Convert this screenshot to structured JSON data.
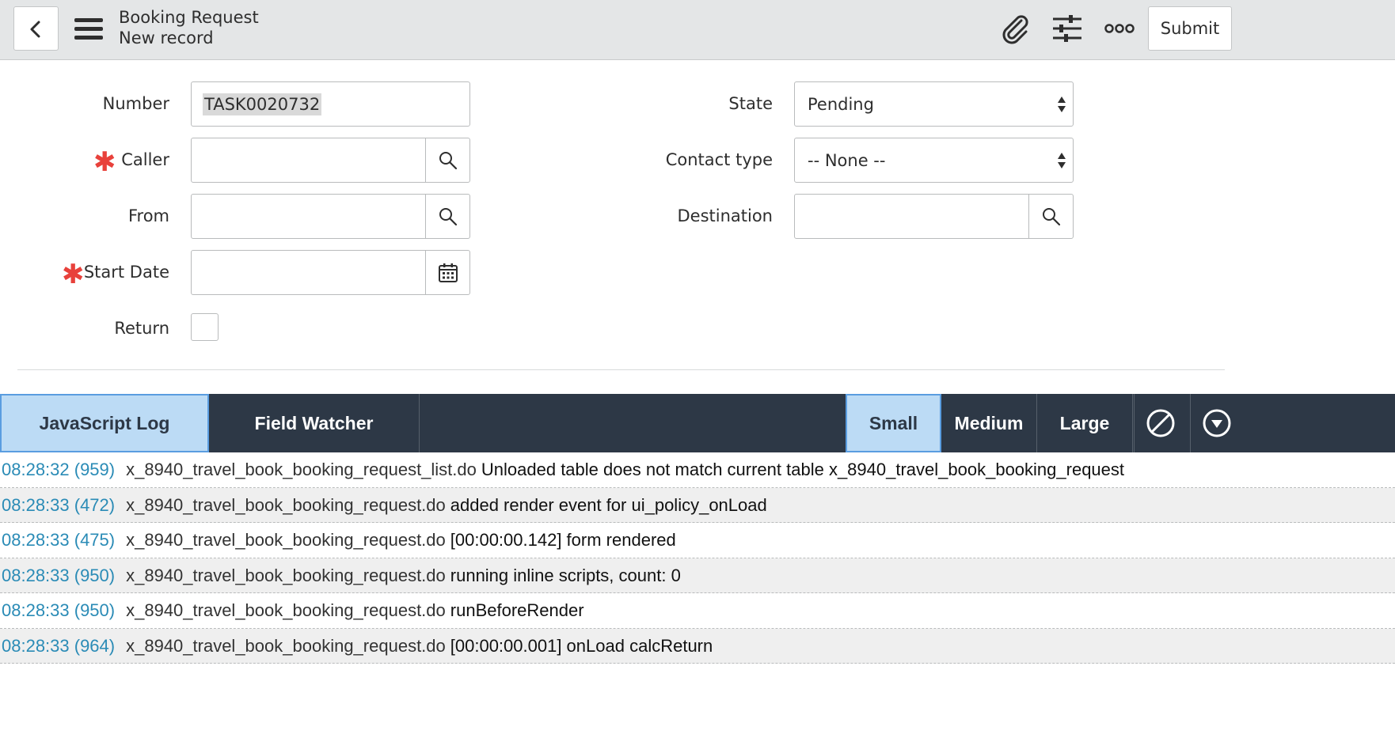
{
  "header": {
    "title": "Booking Request",
    "subtitle": "New record",
    "submit_label": "Submit"
  },
  "form": {
    "number": {
      "label": "Number",
      "value": "TASK0020732"
    },
    "caller": {
      "label": "Caller",
      "value": ""
    },
    "from": {
      "label": "From",
      "value": ""
    },
    "start_date": {
      "label": "Start Date",
      "value": ""
    },
    "return": {
      "label": "Return",
      "checked": false
    },
    "state": {
      "label": "State",
      "value": "Pending"
    },
    "contact_type": {
      "label": "Contact type",
      "value": "-- None --"
    },
    "destination": {
      "label": "Destination",
      "value": ""
    },
    "required_mark": "✱"
  },
  "debug": {
    "tabs": [
      "JavaScript Log",
      "Field Watcher"
    ],
    "sizes": [
      "Small",
      "Medium",
      "Large"
    ],
    "active_tab": "JavaScript Log",
    "active_size": "Small",
    "log": [
      {
        "ts": "08:28:32 (959)",
        "src": "x_8940_travel_book_booking_request_list.do",
        "msg": "Unloaded table does not match current table x_8940_travel_book_booking_request"
      },
      {
        "ts": "08:28:33 (472)",
        "src": "x_8940_travel_book_booking_request.do",
        "msg": "added render event for ui_policy_onLoad"
      },
      {
        "ts": "08:28:33 (475)",
        "src": "x_8940_travel_book_booking_request.do",
        "msg": "[00:00:00.142] form rendered"
      },
      {
        "ts": "08:28:33 (950)",
        "src": "x_8940_travel_book_booking_request.do",
        "msg": "running inline scripts, count: 0"
      },
      {
        "ts": "08:28:33 (950)",
        "src": "x_8940_travel_book_booking_request.do",
        "msg": "runBeforeRender"
      },
      {
        "ts": "08:28:33 (964)",
        "src": "x_8940_travel_book_booking_request.do",
        "msg": "[00:00:00.001] onLoad calcReturn"
      }
    ]
  },
  "colors": {
    "header_bg": "#e4e6e7",
    "debug_bar_bg": "#2d3846",
    "active_tab_bg": "#bcdbf5",
    "timestamp": "#2a8bb6",
    "required": "#e8413b"
  },
  "icons": [
    "back-icon",
    "menu-icon",
    "paperclip-icon",
    "sliders-icon",
    "more-icon",
    "search-icon",
    "calendar-icon",
    "clear-icon",
    "collapse-icon"
  ]
}
